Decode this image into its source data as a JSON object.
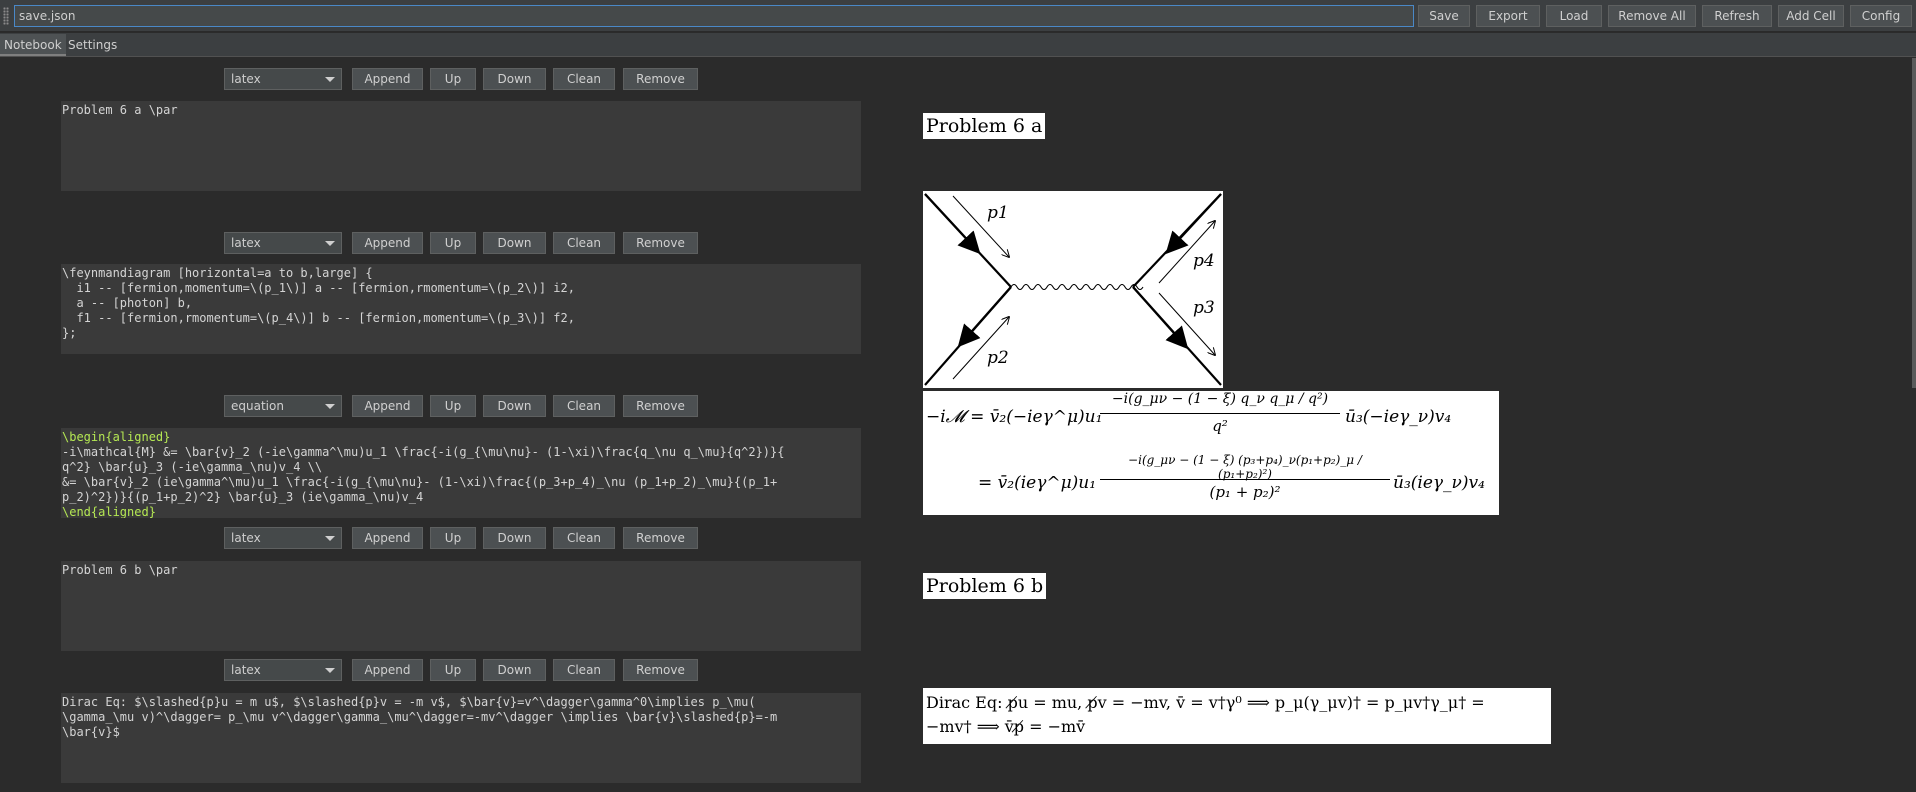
{
  "toolbar": {
    "filename": "save.json",
    "buttons": [
      "Save",
      "Export",
      "Load",
      "Remove All",
      "Refresh",
      "Add Cell",
      "Config"
    ]
  },
  "tabs": [
    "Notebook",
    "Settings"
  ],
  "cell_controls": {
    "append": "Append",
    "up": "Up",
    "down": "Down",
    "clean": "Clean",
    "remove": "Remove"
  },
  "cells": [
    {
      "type": "latex",
      "lines": [
        "Problem 6 a \\par"
      ]
    },
    {
      "type": "latex",
      "lines": [
        "\\feynmandiagram [horizontal=a to b,large] {",
        "  i1 -- [fermion,momentum=\\(p_1\\)] a -- [fermion,rmomentum=\\(p_2\\)] i2,",
        "  a -- [photon] b,",
        "  f1 -- [fermion,rmomentum=\\(p_4\\)] b -- [fermion,momentum=\\(p_3\\)] f2,",
        "};"
      ]
    },
    {
      "type": "equation",
      "lines": [
        "\\begin{aligned}",
        "-i\\mathcal{M} &= \\bar{v}_2 (-ie\\gamma^\\mu)u_1 \\frac{-i(g_{\\mu\\nu}- (1-\\xi)\\frac{q_\\nu q_\\mu}{q^2})}{",
        "q^2} \\bar{u}_3 (-ie\\gamma_\\nu)v_4 \\\\",
        "&= \\bar{v}_2 (ie\\gamma^\\mu)u_1 \\frac{-i(g_{\\mu\\nu}- (1-\\xi)\\frac{(p_3+p_4)_\\nu (p_1+p_2)_\\mu}{(p_1+",
        "p_2)^2})}{(p_1+p_2)^2} \\bar{u}_3 (ie\\gamma_\\nu)v_4",
        "\\end{aligned}"
      ]
    },
    {
      "type": "latex",
      "lines": [
        "Problem 6 b \\par"
      ]
    },
    {
      "type": "latex",
      "lines": [
        "Dirac Eq: $\\slashed{p}u = m u$, $\\slashed{p}v = -m v$, $\\bar{v}=v^\\dagger\\gamma^0\\implies p_\\mu(",
        "\\gamma_\\mu v)^\\dagger= p_\\mu v^\\dagger\\gamma_\\mu^\\dagger=-mv^\\dagger \\implies \\bar{v}\\slashed{p}=-m",
        "\\bar{v}$"
      ]
    }
  ],
  "rendered": {
    "heading_a": "Problem 6 a",
    "heading_b": "Problem 6 b",
    "diagram_labels": [
      "p1",
      "p4",
      "p3",
      "p2"
    ],
    "eq_line1_lhs": "−i𝓜 = v̄₂(−ieγ^μ)u₁",
    "eq_line1_num": "−i(g_μν − (1 − ξ) q_ν q_μ / q²)",
    "eq_line1_den": "q²",
    "eq_line1_tail": "ū₃(−ieγ_ν)v₄",
    "eq_line2_lhs": "= v̄₂(ieγ^μ)u₁",
    "eq_line2_num": "−i(g_μν − (1 − ξ) (p₃+p₄)_ν(p₁+p₂)_μ / (p₁+p₂)²)",
    "eq_line2_den": "(p₁ + p₂)²",
    "eq_line2_tail": "ū₃(ieγ_ν)v₄",
    "dirac_line1": "Dirac Eq: p̸u = mu, p̸v = −mv, v̄ = v†γ⁰ ⟹ p_μ(γ_μv)† = p_μv†γ_μ† =",
    "dirac_line2": "−mv† ⟹ v̄p̸ = −mv̄"
  }
}
